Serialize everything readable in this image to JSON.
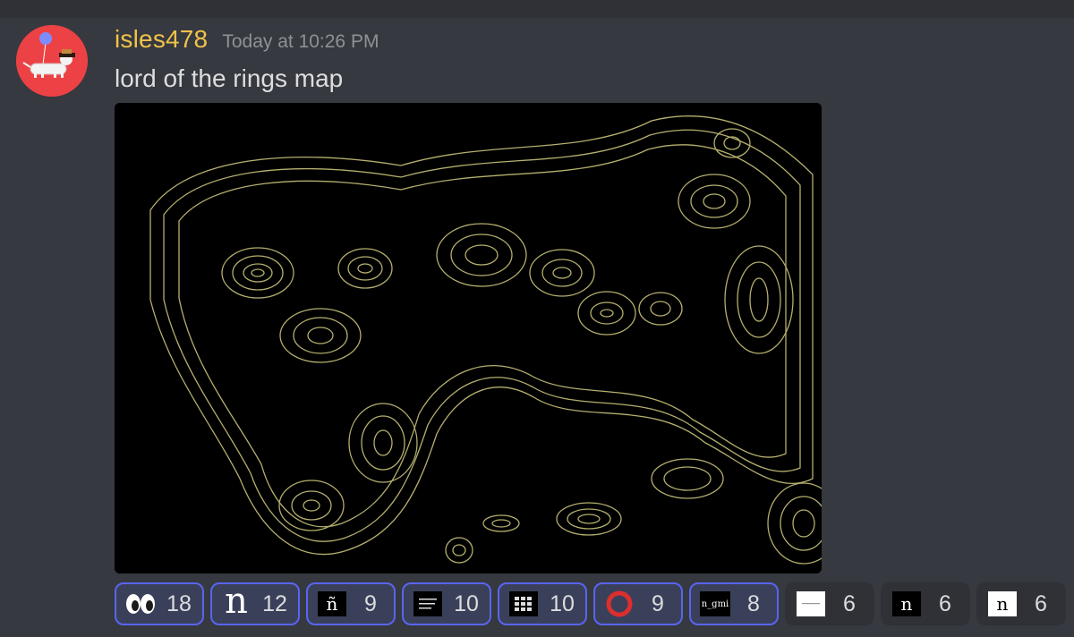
{
  "message": {
    "username": "isles478",
    "timestamp": "Today at 10:26 PM",
    "content": "lord of the rings map",
    "username_color": "#f0c24a",
    "avatar_color": "#ed4245"
  },
  "attachment": {
    "description": "contour map image",
    "background": "#000000",
    "line_color": "#c9c27a"
  },
  "reactions": [
    {
      "emoji": "eyes-emoji",
      "count": "18",
      "selected": true
    },
    {
      "emoji": "n-letter-emoji",
      "glyph": "n",
      "count": "12",
      "selected": true
    },
    {
      "emoji": "n-tilde-emoji",
      "glyph": "ñ",
      "count": "9",
      "selected": true
    },
    {
      "emoji": "tiny-text-emoji",
      "count": "10",
      "selected": true
    },
    {
      "emoji": "n-grid-emoji",
      "count": "10",
      "selected": true
    },
    {
      "emoji": "red-circle-emoji",
      "count": "9",
      "selected": true
    },
    {
      "emoji": "n-gmi-emoji",
      "glyph": "n_gmi",
      "count": "8",
      "selected": true
    },
    {
      "emoji": "white-square-emoji",
      "count": "6",
      "selected": false
    },
    {
      "emoji": "n-box-dark-emoji",
      "glyph": "n",
      "count": "6",
      "selected": false
    },
    {
      "emoji": "n-box-light-emoji",
      "glyph": "n",
      "count": "6",
      "selected": false
    }
  ]
}
